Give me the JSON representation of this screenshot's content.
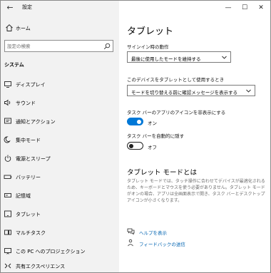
{
  "app": {
    "title": "設定",
    "back_icon": "back-arrow-icon"
  },
  "sidebar": {
    "home_label": "ホーム",
    "search_placeholder": "設定の検索",
    "section_title": "システム",
    "items": [
      {
        "label": "ディスプレイ",
        "icon": "display-icon"
      },
      {
        "label": "サウンド",
        "icon": "sound-icon"
      },
      {
        "label": "通知とアクション",
        "icon": "notifications-icon"
      },
      {
        "label": "集中モード",
        "icon": "focus-assist-icon"
      },
      {
        "label": "電源とスリープ",
        "icon": "power-icon"
      },
      {
        "label": "バッテリー",
        "icon": "battery-icon"
      },
      {
        "label": "記憶域",
        "icon": "storage-icon"
      },
      {
        "label": "タブレット",
        "icon": "tablet-icon"
      },
      {
        "label": "マルチタスク",
        "icon": "multitasking-icon"
      },
      {
        "label": "この PC へのプロジェクション",
        "icon": "projection-icon"
      },
      {
        "label": "共有エクスペリエンス",
        "icon": "shared-experiences-icon"
      }
    ]
  },
  "window_controls": {
    "minimize": "—",
    "maximize": "☐",
    "close": "✕"
  },
  "main": {
    "title": "タブレット",
    "signin_label": "サインイン時の動作",
    "signin_value": "最後に使用したモードを維持する",
    "switch_label": "このデバイスをタブレットとして使用するとき",
    "switch_value": "モードを切り替える前に確認メッセージを表示する",
    "hide_icons_label": "タスク バーのアプリのアイコンを非表示にする",
    "hide_icons_state": "オン",
    "auto_hide_label": "タスク バーを自動的に隠す",
    "auto_hide_state": "オフ",
    "about_heading": "タブレット モードとは",
    "about_text": "タブレット モードでは、タッチ操作に合わせてデバイスが最適化されるため、キーボードとマウスを使う必要がありません。タブレット モードがオンの場合、アプリは全画面表示で開き、タスク バーとデスクトップ アイコンが小さくなります。",
    "help_link": "ヘルプを表示",
    "feedback_link": "フィードバックの送信"
  },
  "colors": {
    "accent": "#0078d7",
    "link": "#0063b1",
    "sidebar_bg": "#f2f2f2"
  }
}
